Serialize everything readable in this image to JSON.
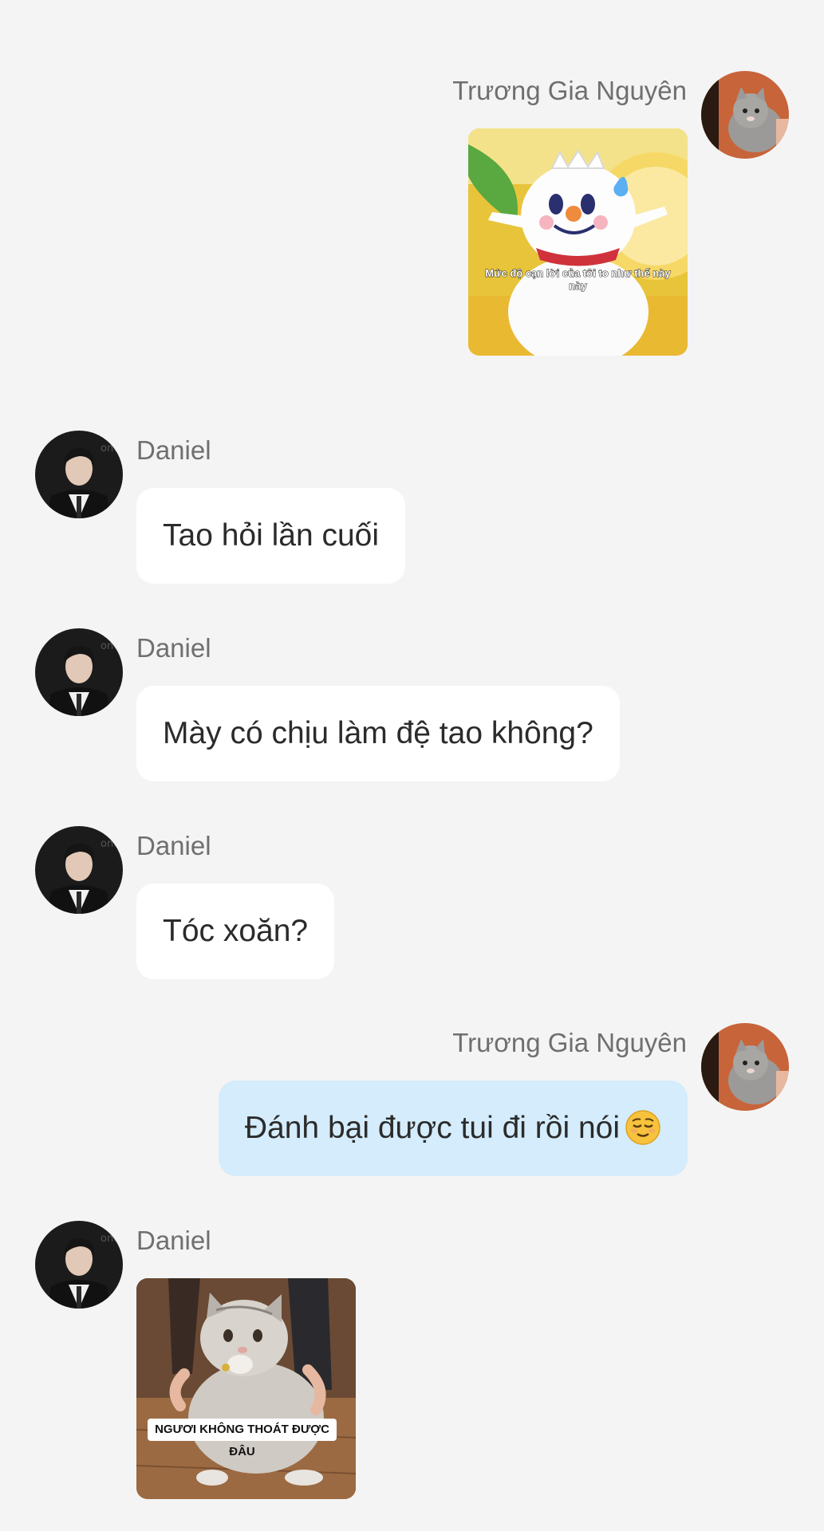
{
  "conversation": {
    "messages": [
      {
        "sender": "Trương Gia Nguyên",
        "type": "sticker",
        "caption": "Mức độ cạn lời của tôi to như thế này này"
      },
      {
        "sender": "Daniel",
        "type": "text",
        "text": "Tao hỏi lần cuối"
      },
      {
        "sender": "Daniel",
        "type": "text",
        "text": "Mày có chịu làm đệ tao không?"
      },
      {
        "sender": "Daniel",
        "type": "text",
        "text": "Tóc xoăn?"
      },
      {
        "sender": "Trương Gia Nguyên",
        "type": "text",
        "text": "Đánh bại được tui đi rồi nói",
        "emoji": "relieved-face"
      },
      {
        "sender": "Daniel",
        "type": "sticker",
        "caption": "NGƯƠI KHÔNG THOÁT ĐƯỢC ĐÂU"
      }
    ]
  },
  "colors": {
    "background": "#f4f4f4",
    "incoming_bubble": "#ffffff",
    "outgoing_bubble": "#d4ecfb",
    "sender_name": "#6f6f6f",
    "message_text": "#2b2b2b"
  },
  "icons": {
    "outgoing_avatar": "cat-avatar",
    "incoming_avatar": "person-avatar"
  }
}
